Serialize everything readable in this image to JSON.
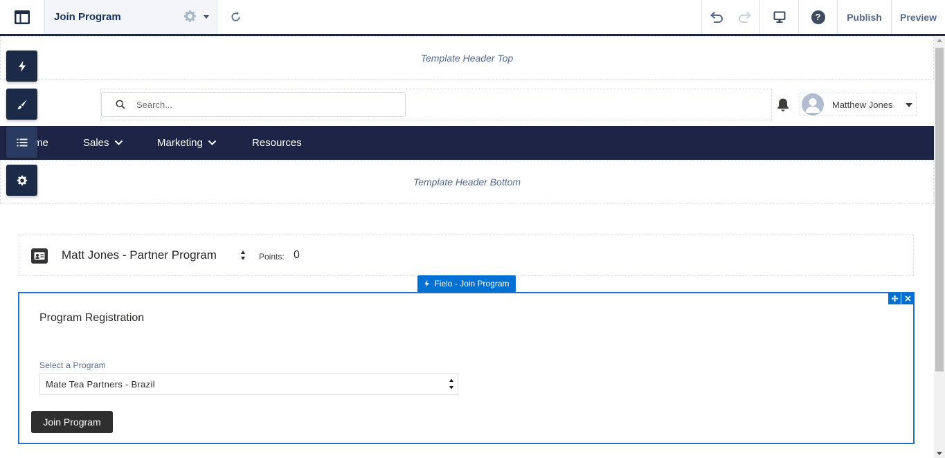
{
  "toolbar": {
    "page_name": "Join Program",
    "publish_label": "Publish",
    "preview_label": "Preview",
    "help_glyph": "?",
    "icons": [
      "layout-icon",
      "gear-icon",
      "refresh-icon",
      "undo-icon",
      "redo-icon",
      "desktop-icon",
      "help-icon"
    ]
  },
  "sidebar_tools": [
    "lightning-icon",
    "brush-icon",
    "list-icon",
    "gear-icon"
  ],
  "canvas": {
    "header_top_label": "Template Header Top",
    "header_bottom_label": "Template Header Bottom",
    "search": {
      "placeholder": "Search..."
    },
    "profile": {
      "name": "Matthew Jones"
    },
    "nav": {
      "items": [
        {
          "label": "me"
        },
        {
          "label": "Sales",
          "has_dropdown": true
        },
        {
          "label": "Marketing",
          "has_dropdown": true
        },
        {
          "label": "Resources"
        }
      ]
    },
    "member_bar": {
      "member_name": "Matt Jones - Partner Program",
      "points_label": "Points:",
      "points_value": "0"
    },
    "component": {
      "tag_label": "Fielo - Join Program",
      "title": "Program Registration",
      "select_label": "Select a Program",
      "select_value": "Mate Tea Partners - Brazil",
      "button_label": "Join Program"
    }
  },
  "colors": {
    "nav_bg": "#1e2445",
    "toolbar_accent": "#1b2a47",
    "selection_blue": "#0070d2",
    "button_dark": "#2f2f2f"
  }
}
